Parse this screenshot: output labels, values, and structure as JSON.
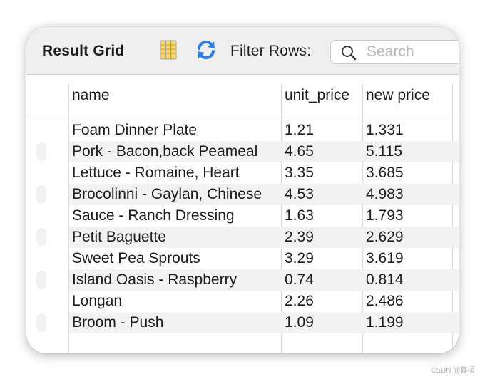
{
  "toolbar": {
    "title": "Result Grid",
    "columns_icon": "grid-columns-icon",
    "refresh_icon": "refresh-icon",
    "filter_label": "Filter Rows:",
    "search_placeholder": "Search",
    "search_icon": "search-icon"
  },
  "columns": [
    "name",
    "unit_price",
    "new price"
  ],
  "rows": [
    {
      "name": "Foam Dinner Plate",
      "unit_price": "1.21",
      "new_price": "1.331"
    },
    {
      "name": "Pork - Bacon,back Peameal",
      "unit_price": "4.65",
      "new_price": "5.115"
    },
    {
      "name": "Lettuce - Romaine, Heart",
      "unit_price": "3.35",
      "new_price": "3.685"
    },
    {
      "name": "Brocolinni - Gaylan, Chinese",
      "unit_price": "4.53",
      "new_price": "4.983"
    },
    {
      "name": "Sauce - Ranch Dressing",
      "unit_price": "1.63",
      "new_price": "1.793"
    },
    {
      "name": "Petit Baguette",
      "unit_price": "2.39",
      "new_price": "2.629"
    },
    {
      "name": "Sweet Pea Sprouts",
      "unit_price": "3.29",
      "new_price": "3.619"
    },
    {
      "name": "Island Oasis - Raspberry",
      "unit_price": "0.74",
      "new_price": "0.814"
    },
    {
      "name": "Longan",
      "unit_price": "2.26",
      "new_price": "2.486"
    },
    {
      "name": "Broom - Push",
      "unit_price": "1.09",
      "new_price": "1.199"
    }
  ],
  "watermark": "CSDN @暮棂",
  "colors": {
    "toolbar_bg": "#efeff0",
    "stripe": "#f2f2f3",
    "refresh_blue": "#2f7ee5",
    "columns_yellow": "#f2c94c"
  }
}
